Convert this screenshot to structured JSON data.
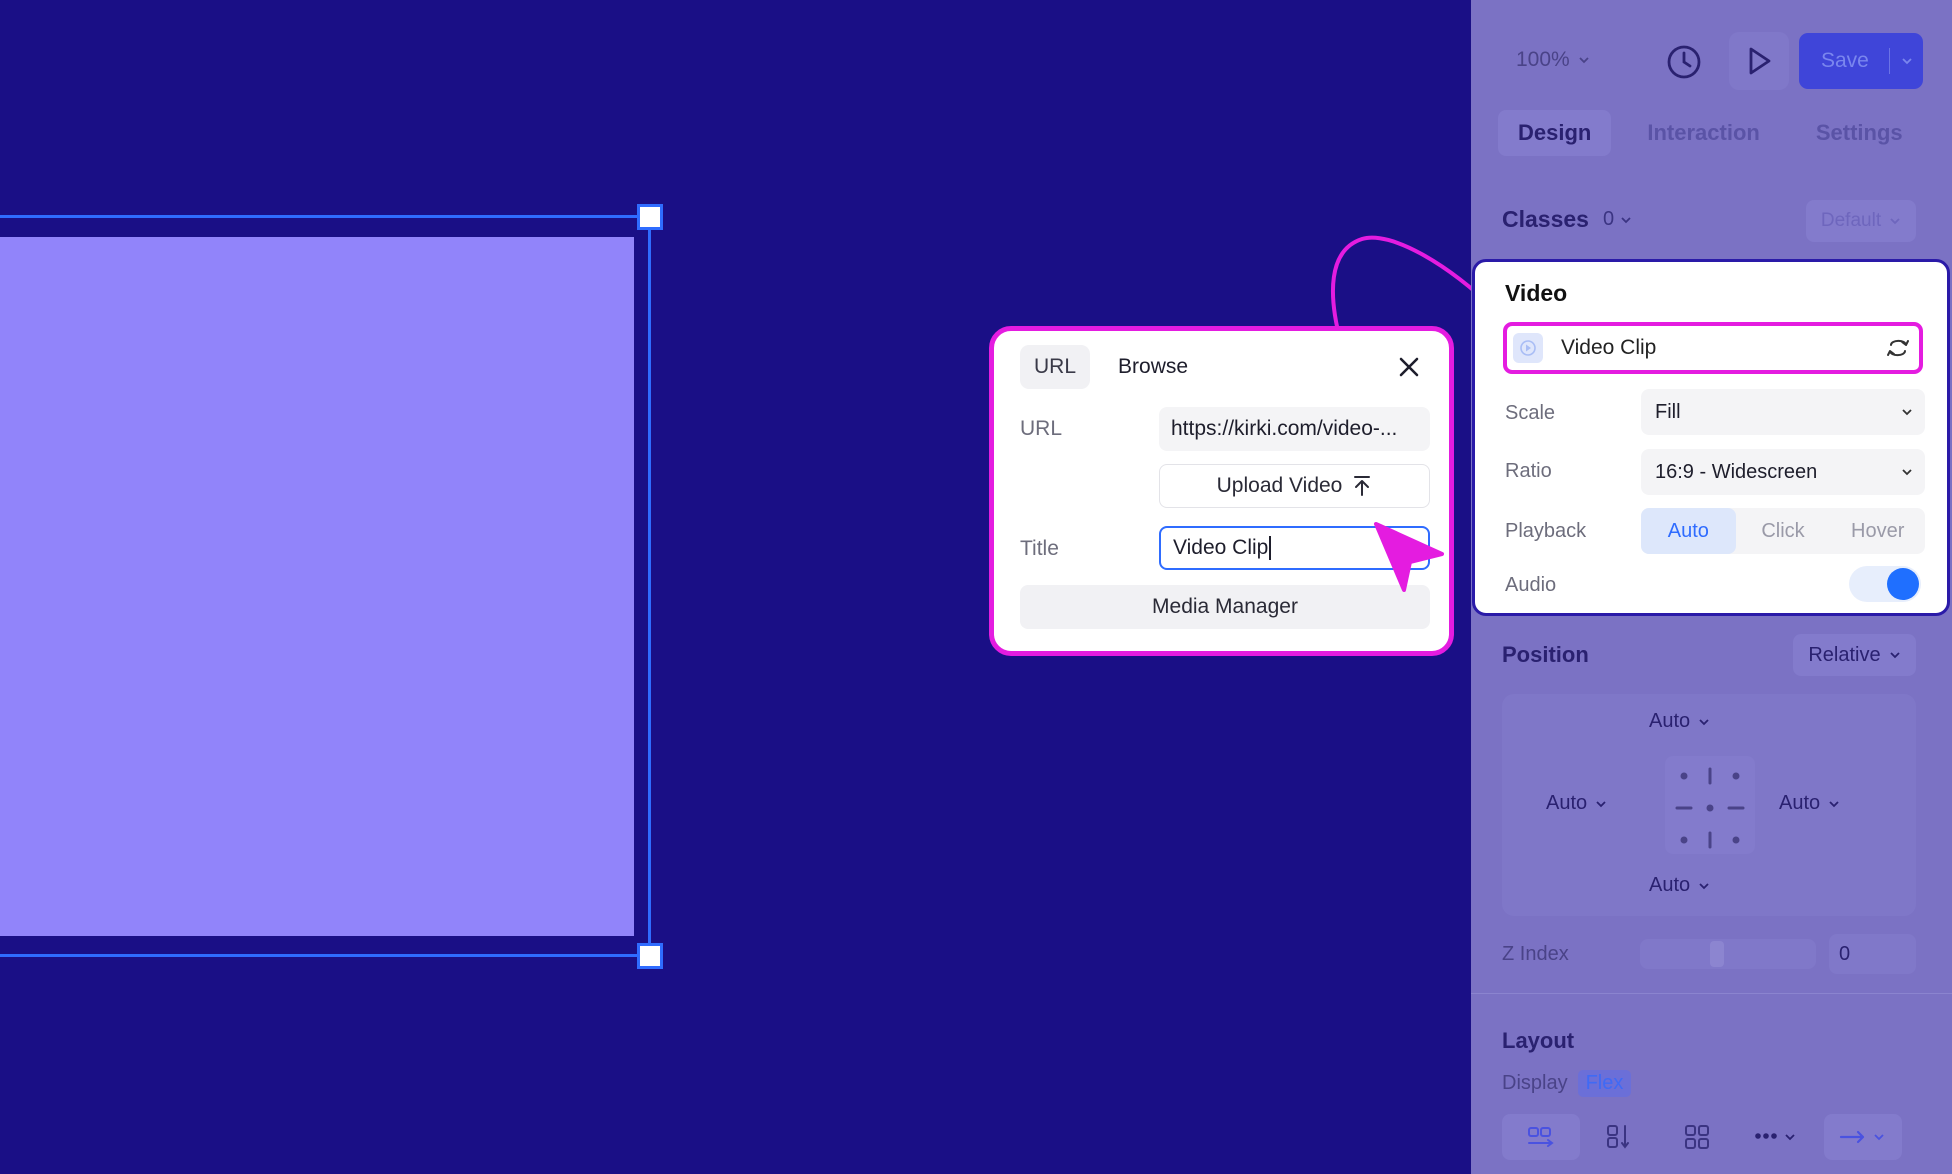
{
  "popup": {
    "tabs": [
      "URL",
      "Browse"
    ],
    "url_label": "URL",
    "url_value": "https://kirki.com/video-...",
    "upload_label": "Upload Video",
    "title_label": "Title",
    "title_value": "Video Clip",
    "media_manager_label": "Media Manager"
  },
  "panel": {
    "zoom": "100%",
    "save_label": "Save",
    "tabs": [
      "Design",
      "Interaction",
      "Settings"
    ],
    "classes_label": "Classes",
    "classes_count": "0",
    "classes_default": "Default",
    "video": {
      "title": "Video",
      "clip_label": "Video Clip",
      "scale_label": "Scale",
      "scale_value": "Fill",
      "ratio_label": "Ratio",
      "ratio_value": "16:9 - Widescreen",
      "playback_label": "Playback",
      "playback_options": [
        "Auto",
        "Click",
        "Hover"
      ],
      "playback_selected": "Auto",
      "audio_label": "Audio",
      "audio_on": true
    },
    "position": {
      "title": "Position",
      "mode": "Relative",
      "top": "Auto",
      "left": "Auto",
      "right": "Auto",
      "bottom": "Auto",
      "zindex_label": "Z Index",
      "zindex_value": "0"
    },
    "layout": {
      "title": "Layout",
      "display_label": "Display",
      "display_value": "Flex"
    }
  },
  "colors": {
    "canvas_bg": "#1a0f86",
    "video_block": "#9184fa",
    "selection": "#2f6cff",
    "highlight": "#e41ce0",
    "accent": "#1f6fff"
  }
}
